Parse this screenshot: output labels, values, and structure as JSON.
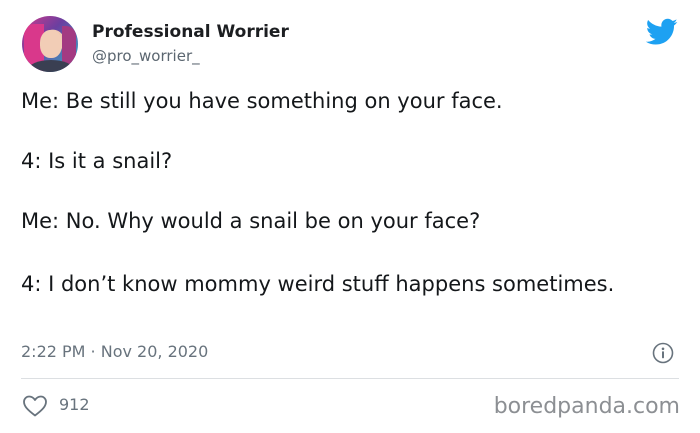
{
  "tweet": {
    "author": {
      "display_name": "Professional Worrier",
      "handle": "@pro_worrier_"
    },
    "lines": [
      "Me: Be still you have something on your face.",
      "4: Is it a snail?",
      "Me: No. Why would a snail be on your face?",
      "4: I don’t know mommy weird stuff happens sometimes."
    ],
    "timestamp": "2:22 PM · Nov 20, 2020",
    "likes": "912",
    "icons": {
      "brand": "twitter-bird-icon",
      "info": "info-icon",
      "like": "heart-icon"
    },
    "colors": {
      "twitter_blue": "#1DA1F2",
      "text": "#14171a",
      "muted": "#68737d"
    }
  },
  "watermark": "boredpanda.com"
}
